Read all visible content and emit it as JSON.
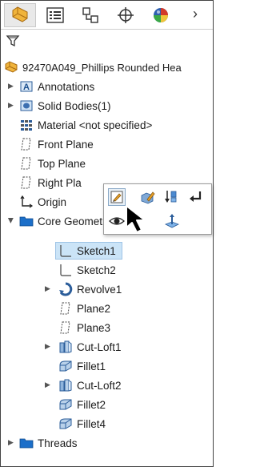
{
  "toolbar": {
    "buttons": [
      {
        "name": "featuremanager-tab",
        "icon": "featuremanager-icon"
      },
      {
        "name": "propertymanager-tab",
        "icon": "propertymanager-icon"
      },
      {
        "name": "configurationmanager-tab",
        "icon": "configurationmanager-icon"
      },
      {
        "name": "dimxpertmanager-tab",
        "icon": "dimxpertmanager-icon"
      },
      {
        "name": "displaymanager-tab",
        "icon": "displaymanager-icon"
      }
    ],
    "more": "›"
  },
  "tree": {
    "root": "92470A049_Phillips Rounded Hea",
    "items": [
      {
        "label": "Annotations"
      },
      {
        "label": "Solid Bodies(1)"
      },
      {
        "label": "Material <not specified>"
      },
      {
        "label": "Front Plane"
      },
      {
        "label": "Top Plane"
      },
      {
        "label": "Right Pla"
      },
      {
        "label": "Origin"
      },
      {
        "label": "Core Geometry"
      },
      {
        "label": "Sketch1"
      },
      {
        "label": "Sketch2"
      },
      {
        "label": "Revolve1"
      },
      {
        "label": "Plane2"
      },
      {
        "label": "Plane3"
      },
      {
        "label": "Cut-Loft1"
      },
      {
        "label": "Fillet1"
      },
      {
        "label": "Cut-Loft2"
      },
      {
        "label": "Fillet2"
      },
      {
        "label": "Fillet4"
      },
      {
        "label": "Threads"
      }
    ]
  },
  "colors": {
    "selection": "#cbe4f7",
    "folder": "#1c6fc9",
    "accent_orange": "#e8a128"
  }
}
